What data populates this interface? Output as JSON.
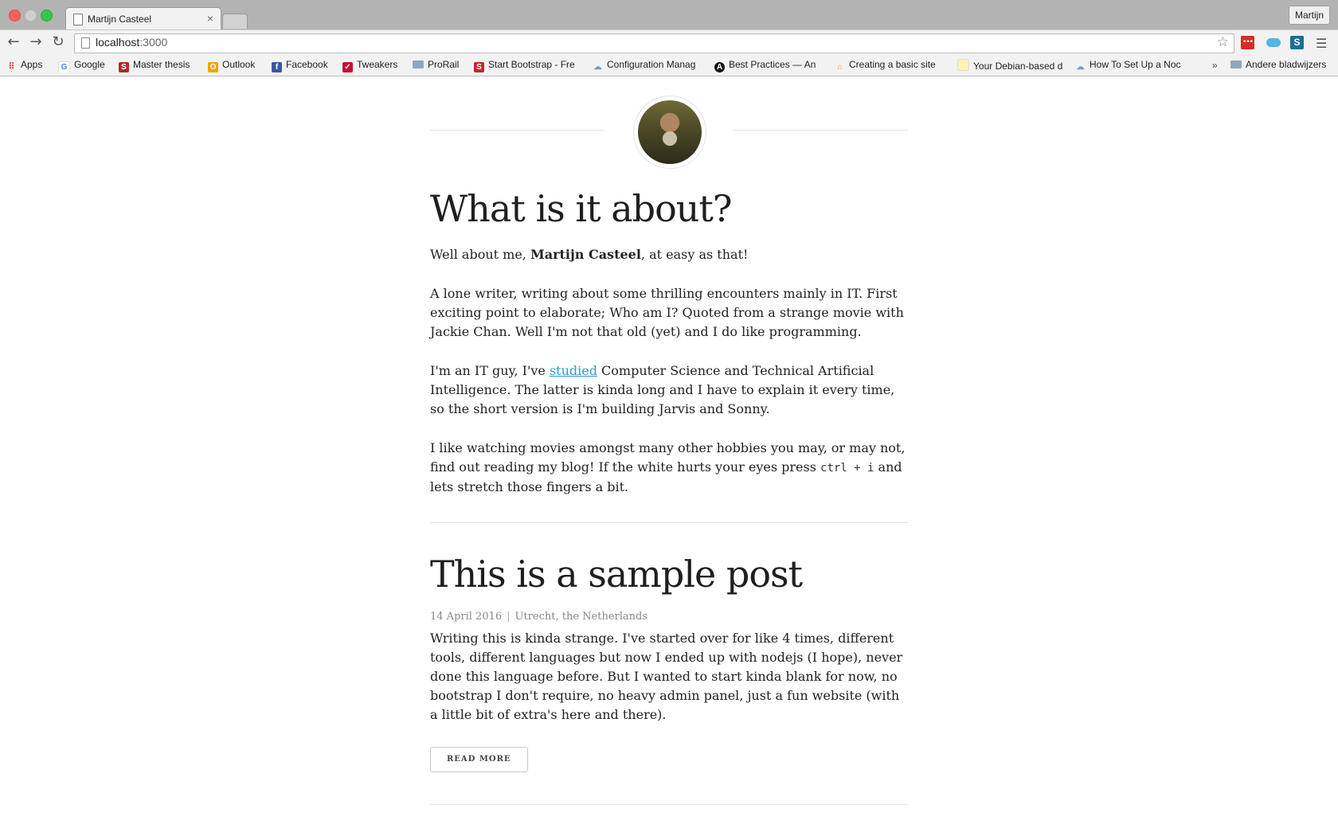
{
  "browser": {
    "tab_title": "Martijn Casteel",
    "tab_close": "×",
    "profile_name": "Martijn",
    "url_host": "localhost",
    "url_port": ":3000",
    "bookmarks": [
      {
        "label": "Apps",
        "icon": "apps-grid-icon"
      },
      {
        "label": "Google",
        "icon": "google-icon"
      },
      {
        "label": "Master thesis",
        "icon": "s-red-icon"
      },
      {
        "label": "Outlook",
        "icon": "outlook-icon"
      },
      {
        "label": "Facebook",
        "icon": "facebook-icon"
      },
      {
        "label": "Tweakers",
        "icon": "tweakers-icon"
      },
      {
        "label": "ProRail",
        "icon": "folder-icon"
      },
      {
        "label": "Start Bootstrap - Fre",
        "icon": "s-red-icon"
      },
      {
        "label": "Configuration Manag",
        "icon": "cloud-icon"
      },
      {
        "label": "Best Practices — An",
        "icon": "angular-icon"
      },
      {
        "label": "Creating a basic site",
        "icon": "home-icon"
      },
      {
        "label": "Your Debian-based d",
        "icon": "page-icon"
      },
      {
        "label": "How To Set Up a Noc",
        "icon": "cloud-icon"
      }
    ],
    "bookmarks_overflow": "»",
    "other_bookmarks": "Andere bladwijzers"
  },
  "about": {
    "title": "What is it about?",
    "intro_prefix": "Well about me, ",
    "intro_name": "Martijn Casteel",
    "intro_suffix": ", at easy as that!",
    "p2": "A lone writer, writing about some thrilling encounters mainly in IT. First exciting point to elaborate; Who am I? Quoted from a strange movie with Jackie Chan. Well I'm not that old (yet) and I do like programming.",
    "p3_prefix": "I'm an IT guy, I've ",
    "p3_link": "studied",
    "p3_suffix": " Computer Science and Technical Artificial Intelligence. The latter is kinda long and I have to explain it every time, so the short version is I'm building Jarvis and Sonny.",
    "p4_prefix": "I like watching movies amongst many other hobbies you may, or may not, find out reading my blog! If the white hurts your eyes press ",
    "p4_code": "ctrl + i",
    "p4_suffix": " and lets stretch those fingers a bit."
  },
  "post": {
    "title": "This is a sample post",
    "date": "14 April 2016",
    "separator": "|",
    "location": "Utrecht, the Netherlands",
    "excerpt": "Writing this is kinda strange. I've started over for like 4 times, different tools, different languages but now I ended up with nodejs (I hope), never done this language before. But I wanted to start kinda blank for now, no bootstrap I don't require, no heavy admin panel, just a fun website (with a little bit of extra's here and there).",
    "read_more": "READ MORE"
  }
}
